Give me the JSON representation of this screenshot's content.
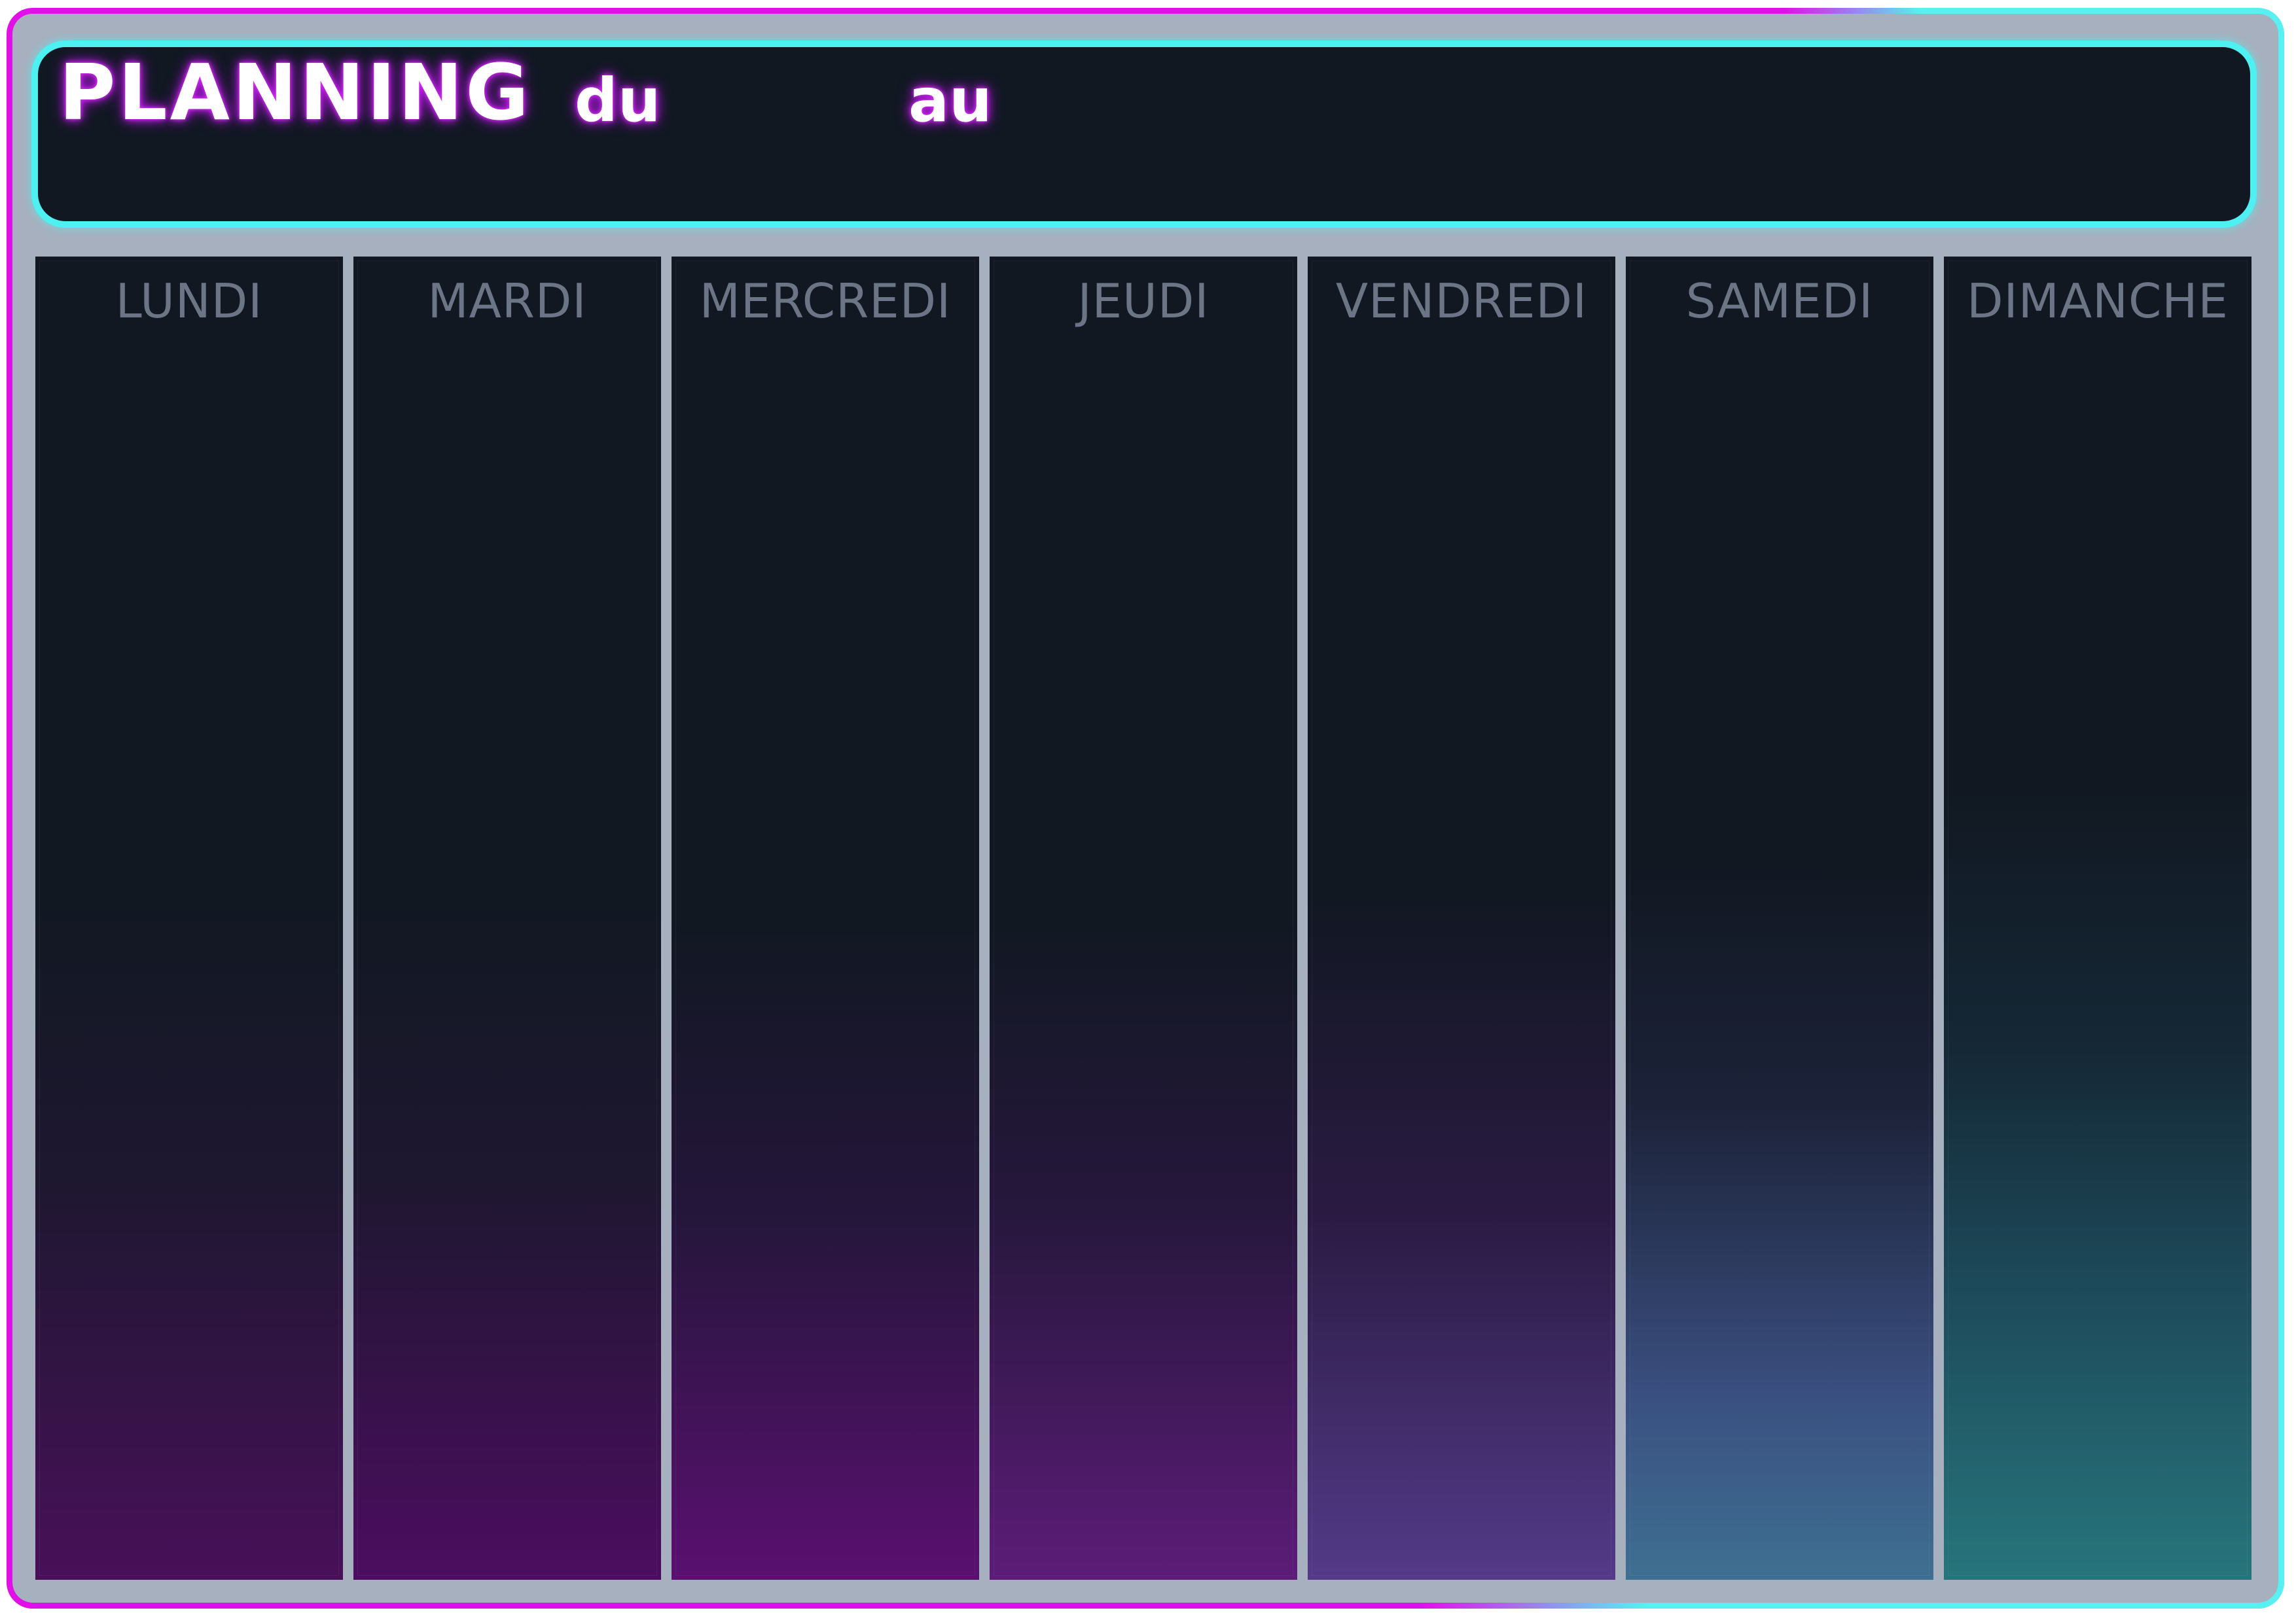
{
  "header": {
    "title": "PLANNING",
    "from_label": "du",
    "to_label": "au"
  },
  "days": [
    {
      "label": "LUNDI"
    },
    {
      "label": "MARDI"
    },
    {
      "label": "MERCREDI"
    },
    {
      "label": "JEUDI"
    },
    {
      "label": "VENDREDI"
    },
    {
      "label": "SAMEDI"
    },
    {
      "label": "DIMANCHE"
    }
  ],
  "colors": {
    "frame_magenta": "#e010e6",
    "frame_cyan": "#58f0f0",
    "background_gray": "#a7b0be",
    "panel_dark": "#111822",
    "header_border": "#4ff0f2",
    "day_label": "#6b7585"
  }
}
